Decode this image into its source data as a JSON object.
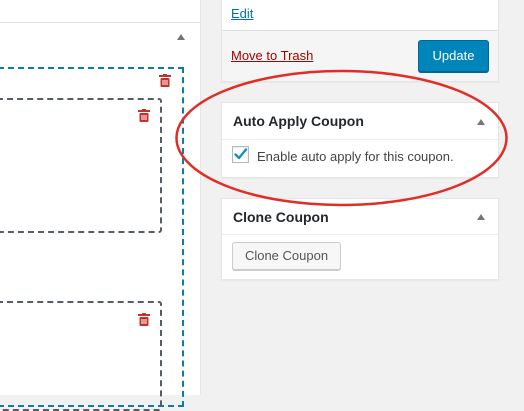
{
  "publish": {
    "edit_label": "Edit",
    "trash_label": "Move to Trash",
    "update_label": "Update"
  },
  "auto_apply": {
    "title": "Auto Apply Coupon",
    "checkbox_label": "Enable auto apply for this coupon.",
    "checked": true
  },
  "clone": {
    "title": "Clone Coupon",
    "button_label": "Clone Coupon"
  },
  "colors": {
    "primary": "#0085ba",
    "link": "#0073aa",
    "danger": "#a00",
    "trash_icon": "#c4322b",
    "dashed_outer": "#0a7fa5",
    "highlight": "#e02e24"
  },
  "icons": {
    "collapse": "triangle-up-icon",
    "delete": "trash-icon",
    "check": "checkmark-icon"
  }
}
